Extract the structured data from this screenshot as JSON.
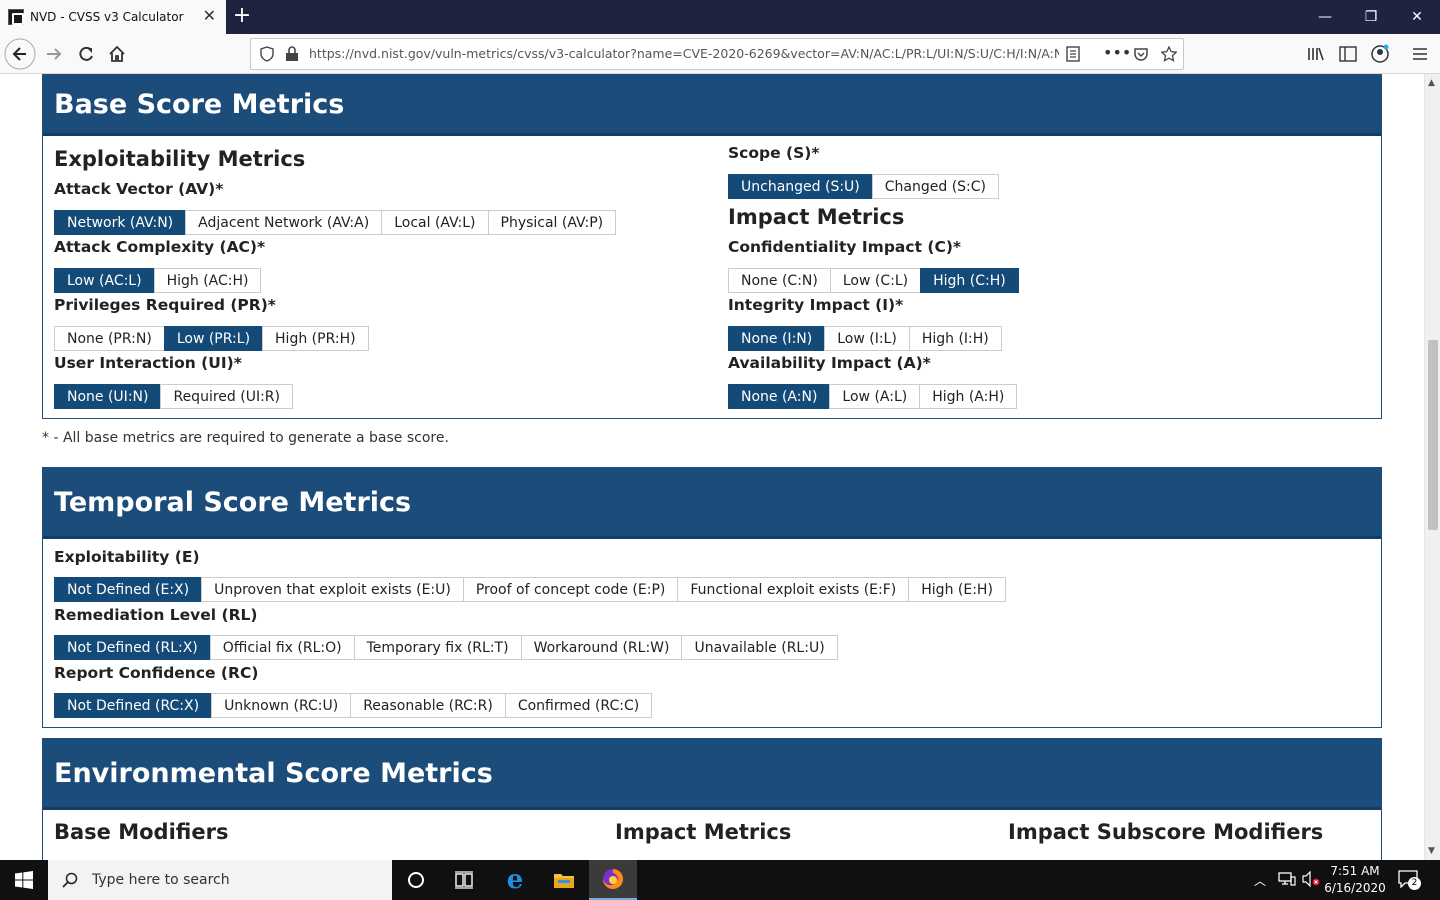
{
  "browser": {
    "tab_title": "NVD - CVSS v3 Calculator",
    "url": "https://nvd.nist.gov/vuln-metrics/cvss/v3-calculator?name=CVE-2020-6269&vector=AV:N/AC:L/PR:L/UI:N/S:U/C:H/I:N/A:N"
  },
  "base": {
    "header": "Base Score Metrics",
    "exploitability_title": "Exploitability Metrics",
    "impact_title": "Impact Metrics",
    "metrics": [
      {
        "label": "Attack Vector (AV)*",
        "options": [
          "Network (AV:N)",
          "Adjacent Network (AV:A)",
          "Local (AV:L)",
          "Physical (AV:P)"
        ],
        "selected": 0
      },
      {
        "label": "Attack Complexity (AC)*",
        "options": [
          "Low (AC:L)",
          "High (AC:H)"
        ],
        "selected": 0
      },
      {
        "label": "Privileges Required (PR)*",
        "options": [
          "None (PR:N)",
          "Low (PR:L)",
          "High (PR:H)"
        ],
        "selected": 1
      },
      {
        "label": "User Interaction (UI)*",
        "options": [
          "None (UI:N)",
          "Required (UI:R)"
        ],
        "selected": 0
      },
      {
        "label": "Scope (S)*",
        "options": [
          "Unchanged (S:U)",
          "Changed (S:C)"
        ],
        "selected": 0
      },
      {
        "label": "Confidentiality Impact (C)*",
        "options": [
          "None (C:N)",
          "Low (C:L)",
          "High (C:H)"
        ],
        "selected": 2
      },
      {
        "label": "Integrity Impact (I)*",
        "options": [
          "None (I:N)",
          "Low (I:L)",
          "High (I:H)"
        ],
        "selected": 0
      },
      {
        "label": "Availability Impact (A)*",
        "options": [
          "None (A:N)",
          "Low (A:L)",
          "High (A:H)"
        ],
        "selected": 0
      }
    ],
    "note": "* - All base metrics are required to generate a base score."
  },
  "temporal": {
    "header": "Temporal Score Metrics",
    "metrics": [
      {
        "label": "Exploitability (E)",
        "options": [
          "Not Defined (E:X)",
          "Unproven that exploit exists (E:U)",
          "Proof of concept code (E:P)",
          "Functional exploit exists (E:F)",
          "High (E:H)"
        ],
        "selected": 0
      },
      {
        "label": "Remediation Level (RL)",
        "options": [
          "Not Defined (RL:X)",
          "Official fix (RL:O)",
          "Temporary fix (RL:T)",
          "Workaround (RL:W)",
          "Unavailable (RL:U)"
        ],
        "selected": 0
      },
      {
        "label": "Report Confidence (RC)",
        "options": [
          "Not Defined (RC:X)",
          "Unknown (RC:U)",
          "Reasonable (RC:R)",
          "Confirmed (RC:C)"
        ],
        "selected": 0
      }
    ]
  },
  "environmental": {
    "header": "Environmental Score Metrics",
    "col1": "Base Modifiers",
    "col2": "Impact Metrics",
    "col3": "Impact Subscore Modifiers"
  },
  "taskbar": {
    "search_placeholder": "Type here to search",
    "time": "7:51 AM",
    "date": "6/16/2020",
    "notifications": "2"
  },
  "colors": {
    "header_blue": "#1c4c7a",
    "selected_blue": "#134a78",
    "titlebar": "#202340"
  }
}
